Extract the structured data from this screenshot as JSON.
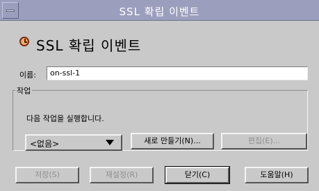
{
  "window": {
    "title": "SSL 확립 이벤트"
  },
  "header": {
    "title": "SSL 확립 이벤트",
    "icon": "event-clock-icon"
  },
  "name_field": {
    "label": "이름:",
    "value": "on-ssl-1"
  },
  "task_group": {
    "title": "작업",
    "description": "다음 작업을 실행합니다.",
    "select_value": "<없음>",
    "new_button": "새로 만들기(N)...",
    "edit_button": "편집(E)..."
  },
  "buttons": {
    "save": "저장(S)",
    "reset": "재설정(R)",
    "close": "닫기(C)",
    "help": "도움말(H)"
  }
}
